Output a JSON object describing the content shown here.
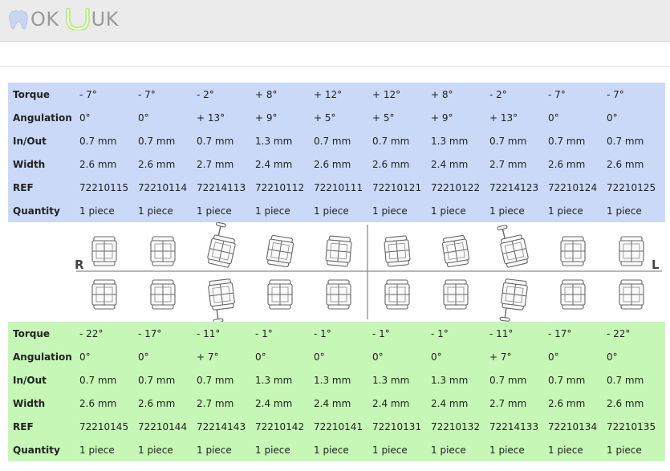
{
  "brand": {
    "part1": "OK",
    "part2": "UK"
  },
  "upper": {
    "rows": [
      {
        "label": "Torque",
        "values": [
          "- 7°",
          "- 7°",
          "- 2°",
          "+ 8°",
          "+ 12°",
          "+ 12°",
          "+ 8°",
          "- 2°",
          "- 7°",
          "- 7°"
        ]
      },
      {
        "label": "Angulation",
        "values": [
          "0°",
          "0°",
          "+ 13°",
          "+ 9°",
          "+ 5°",
          "+ 5°",
          "+ 9°",
          "+ 13°",
          "0°",
          "0°"
        ]
      },
      {
        "label": "In/Out",
        "values": [
          "0.7 mm",
          "0.7 mm",
          "0.7 mm",
          "1.3 mm",
          "0.7 mm",
          "0.7 mm",
          "1.3 mm",
          "0.7 mm",
          "0.7 mm",
          "0.7 mm"
        ]
      },
      {
        "label": "Width",
        "values": [
          "2.6 mm",
          "2.6 mm",
          "2.7 mm",
          "2.4 mm",
          "2.6 mm",
          "2.6 mm",
          "2.4 mm",
          "2.7 mm",
          "2.6 mm",
          "2.6 mm"
        ]
      },
      {
        "label": "REF",
        "values": [
          "72210115",
          "72210114",
          "72214113",
          "72210112",
          "72210111",
          "72210121",
          "72210122",
          "72214123",
          "72210124",
          "72210125"
        ]
      },
      {
        "label": "Quantity",
        "values": [
          "1 piece",
          "1 piece",
          "1 piece",
          "1 piece",
          "1 piece",
          "1 piece",
          "1 piece",
          "1 piece",
          "1 piece",
          "1 piece"
        ]
      }
    ]
  },
  "lower": {
    "rows": [
      {
        "label": "Torque",
        "values": [
          "- 22°",
          "- 17°",
          "- 11°",
          "- 1°",
          "- 1°",
          "- 1°",
          "- 1°",
          "- 11°",
          "- 17°",
          "- 22°"
        ]
      },
      {
        "label": "Angulation",
        "values": [
          "0°",
          "0°",
          "+ 7°",
          "0°",
          "0°",
          "0°",
          "0°",
          "+ 7°",
          "0°",
          "0°"
        ]
      },
      {
        "label": "In/Out",
        "values": [
          "0.7 mm",
          "0.7 mm",
          "0.7 mm",
          "1.3 mm",
          "1.3 mm",
          "1.3 mm",
          "1.3 mm",
          "0.7 mm",
          "0.7 mm",
          "0.7 mm"
        ]
      },
      {
        "label": "Width",
        "values": [
          "2.6 mm",
          "2.6 mm",
          "2.7 mm",
          "2.4 mm",
          "2.4 mm",
          "2.4 mm",
          "2.4 mm",
          "2.7 mm",
          "2.6 mm",
          "2.6 mm"
        ]
      },
      {
        "label": "REF",
        "values": [
          "72210145",
          "72210144",
          "72214143",
          "72210142",
          "72210141",
          "72210131",
          "72210132",
          "72214133",
          "72210134",
          "72210135"
        ]
      },
      {
        "label": "Quantity",
        "values": [
          "1 piece",
          "1 piece",
          "1 piece",
          "1 piece",
          "1 piece",
          "1 piece",
          "1 piece",
          "1 piece",
          "1 piece",
          "1 piece"
        ]
      }
    ]
  },
  "diagram": {
    "right_label": "R",
    "left_label": "L",
    "upper_teeth": [
      {
        "kind": "plain",
        "tilt": 0
      },
      {
        "kind": "plain",
        "tilt": 0
      },
      {
        "kind": "hook",
        "tilt": 13
      },
      {
        "kind": "plain",
        "tilt": 9
      },
      {
        "kind": "plain",
        "tilt": 5
      },
      {
        "kind": "plain",
        "tilt": -5
      },
      {
        "kind": "plain",
        "tilt": -9
      },
      {
        "kind": "hook",
        "tilt": -13
      },
      {
        "kind": "plain",
        "tilt": 0
      },
      {
        "kind": "plain",
        "tilt": 0
      }
    ],
    "lower_teeth": [
      {
        "kind": "plain",
        "tilt": 0
      },
      {
        "kind": "plain",
        "tilt": 0
      },
      {
        "kind": "hook",
        "tilt": -7
      },
      {
        "kind": "plain",
        "tilt": 0
      },
      {
        "kind": "plain",
        "tilt": 0
      },
      {
        "kind": "plain",
        "tilt": 0
      },
      {
        "kind": "plain",
        "tilt": 0
      },
      {
        "kind": "hook",
        "tilt": 7
      },
      {
        "kind": "plain",
        "tilt": 0
      },
      {
        "kind": "plain",
        "tilt": 0
      }
    ]
  },
  "colors": {
    "upper_bg": "#cad9f7",
    "lower_bg": "#c6f7b6",
    "logo_tooth": "#c9d6f0",
    "logo_u": "#b8ef8e"
  }
}
